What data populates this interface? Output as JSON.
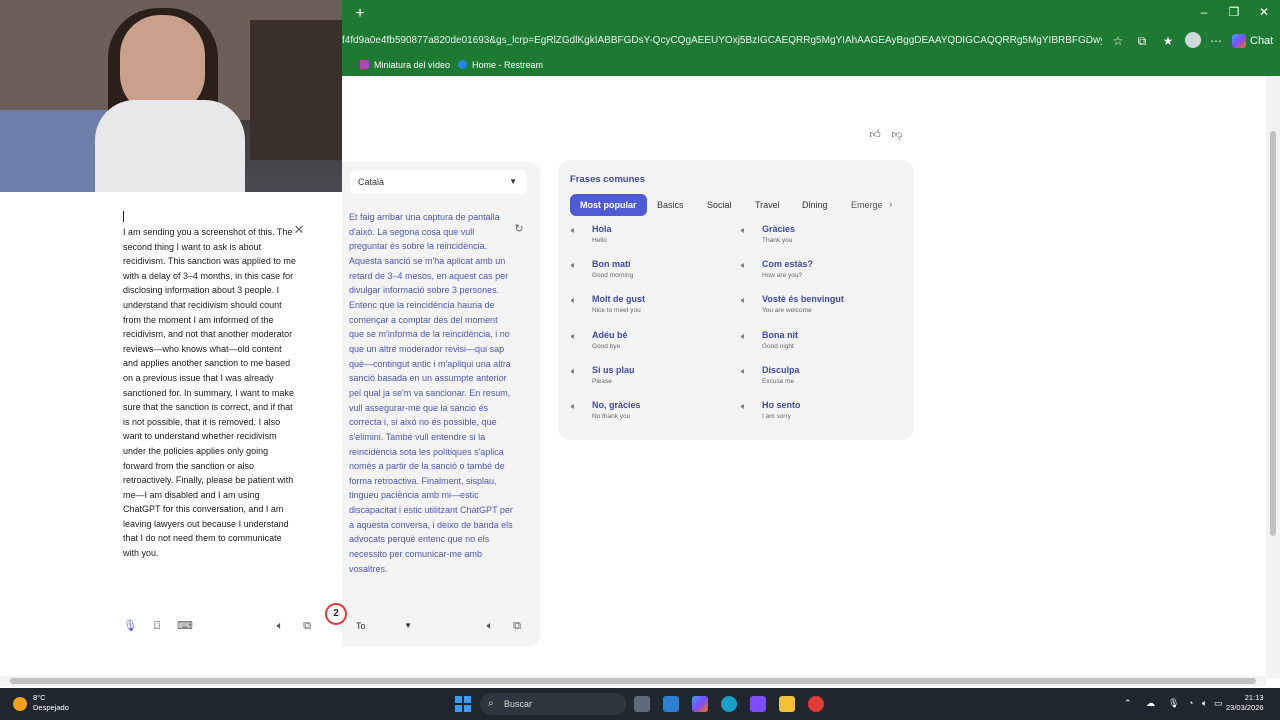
{
  "browser": {
    "url": "f4fd9a0e4fb590877a820de01693&gs_lcrp=EgRlZGdlKgkIABBFGDsY-QcyCQgAEEUYOxj5BzIGCAEQRRg5MgYIAhAAGEAyBggDEAAYQDIGCAQQRRg5MgYIBRBFGDwyBggGEEUYPDIGCAc...",
    "chat_label": "Chat",
    "bookmarks": [
      {
        "label": "Miniatura del vídeo",
        "color": "#ab47bc"
      },
      {
        "label": "Home - Restream",
        "color": "#1e88e5"
      }
    ]
  },
  "translator": {
    "source_text": "I am sending you a screenshot of this. The second thing I want to ask is about recidivism. This sanction was applied to me with a delay of 3–4 months, in this case for disclosing information about 3 people. I understand that recidivism should count from the moment I am informed of the recidivism, and not that another moderator reviews—who knows what—old content and applies another sanction to me based on a previous issue that I was already sanctioned for. In summary, I want to make sure that the sanction is correct, and if that is not possible, that it is removed. I also want to understand whether recidivism under the policies applies only going forward from the sanction or also retroactively. Finally, please be patient with me—I am disabled and I am using ChatGPT for this conversation, and I am leaving lawyers out because I understand that I do not need them to communicate with you.",
    "target_language": "Català",
    "target_text": "Et faig arribar una captura de pantalla d'això. La segona cosa que vull preguntar és sobre la reincidència. Aquesta sanció se m'ha aplicat amb un retard de 3–4 mesos, en aquest cas per divulgar informació sobre 3 persones. Entenc que la reincidència hauria de començar a comptar des del moment que se m'informa de la reincidència, i no que un altre moderador revisi—qui sap què—contingut antic i m'apliqui una altra sanció basada en un assumpte anterior pel qual ja se'm va sancionar. En resum, vull assegurar-me que la sanció és correcta i, si això no és possible, que s'elimini. També vull entendre si la reincidència sota les polítiques s'aplica només a partir de la sanció o també de forma retroactiva. Finalment, sisplau, tingueu paciència amb mi—estic discapacitat i estic utilitzant ChatGPT per a aquesta conversa, i deixo de banda els advocats perquè entenc que no els necessito per comunicar-me amb vosaltres.",
    "badge_count": "2",
    "to_label": "To"
  },
  "phrases": {
    "title": "Frases comunes",
    "tabs": [
      "Most popular",
      "Basics",
      "Social",
      "Travel",
      "Dining",
      "Emerge"
    ],
    "items": [
      {
        "word": "Hola",
        "translation": "Hello"
      },
      {
        "word": "Gràcies",
        "translation": "Thank you"
      },
      {
        "word": "Bon matí",
        "translation": "Good morning"
      },
      {
        "word": "Com estàs?",
        "translation": "How are you?"
      },
      {
        "word": "Molt de gust",
        "translation": "Nice to meet you"
      },
      {
        "word": "Vostè és benvingut",
        "translation": "You are welcome"
      },
      {
        "word": "Adéu bé",
        "translation": "Good bye"
      },
      {
        "word": "Bona nit",
        "translation": "Good night"
      },
      {
        "word": "Si us plau",
        "translation": "Please"
      },
      {
        "word": "Disculpa",
        "translation": "Excuse me"
      },
      {
        "word": "No, gràcies",
        "translation": "No thank you"
      },
      {
        "word": "Ho sento",
        "translation": "I am sorry"
      }
    ]
  },
  "taskbar": {
    "temperature": "8°C",
    "weather": "Despejado",
    "search_placeholder": "Buscar",
    "time": "21:13",
    "date": "23/03/2026"
  },
  "colors": {
    "chrome": "#1e7a32",
    "accent": "#4f5bd5",
    "target_text": "#4b57b8"
  }
}
